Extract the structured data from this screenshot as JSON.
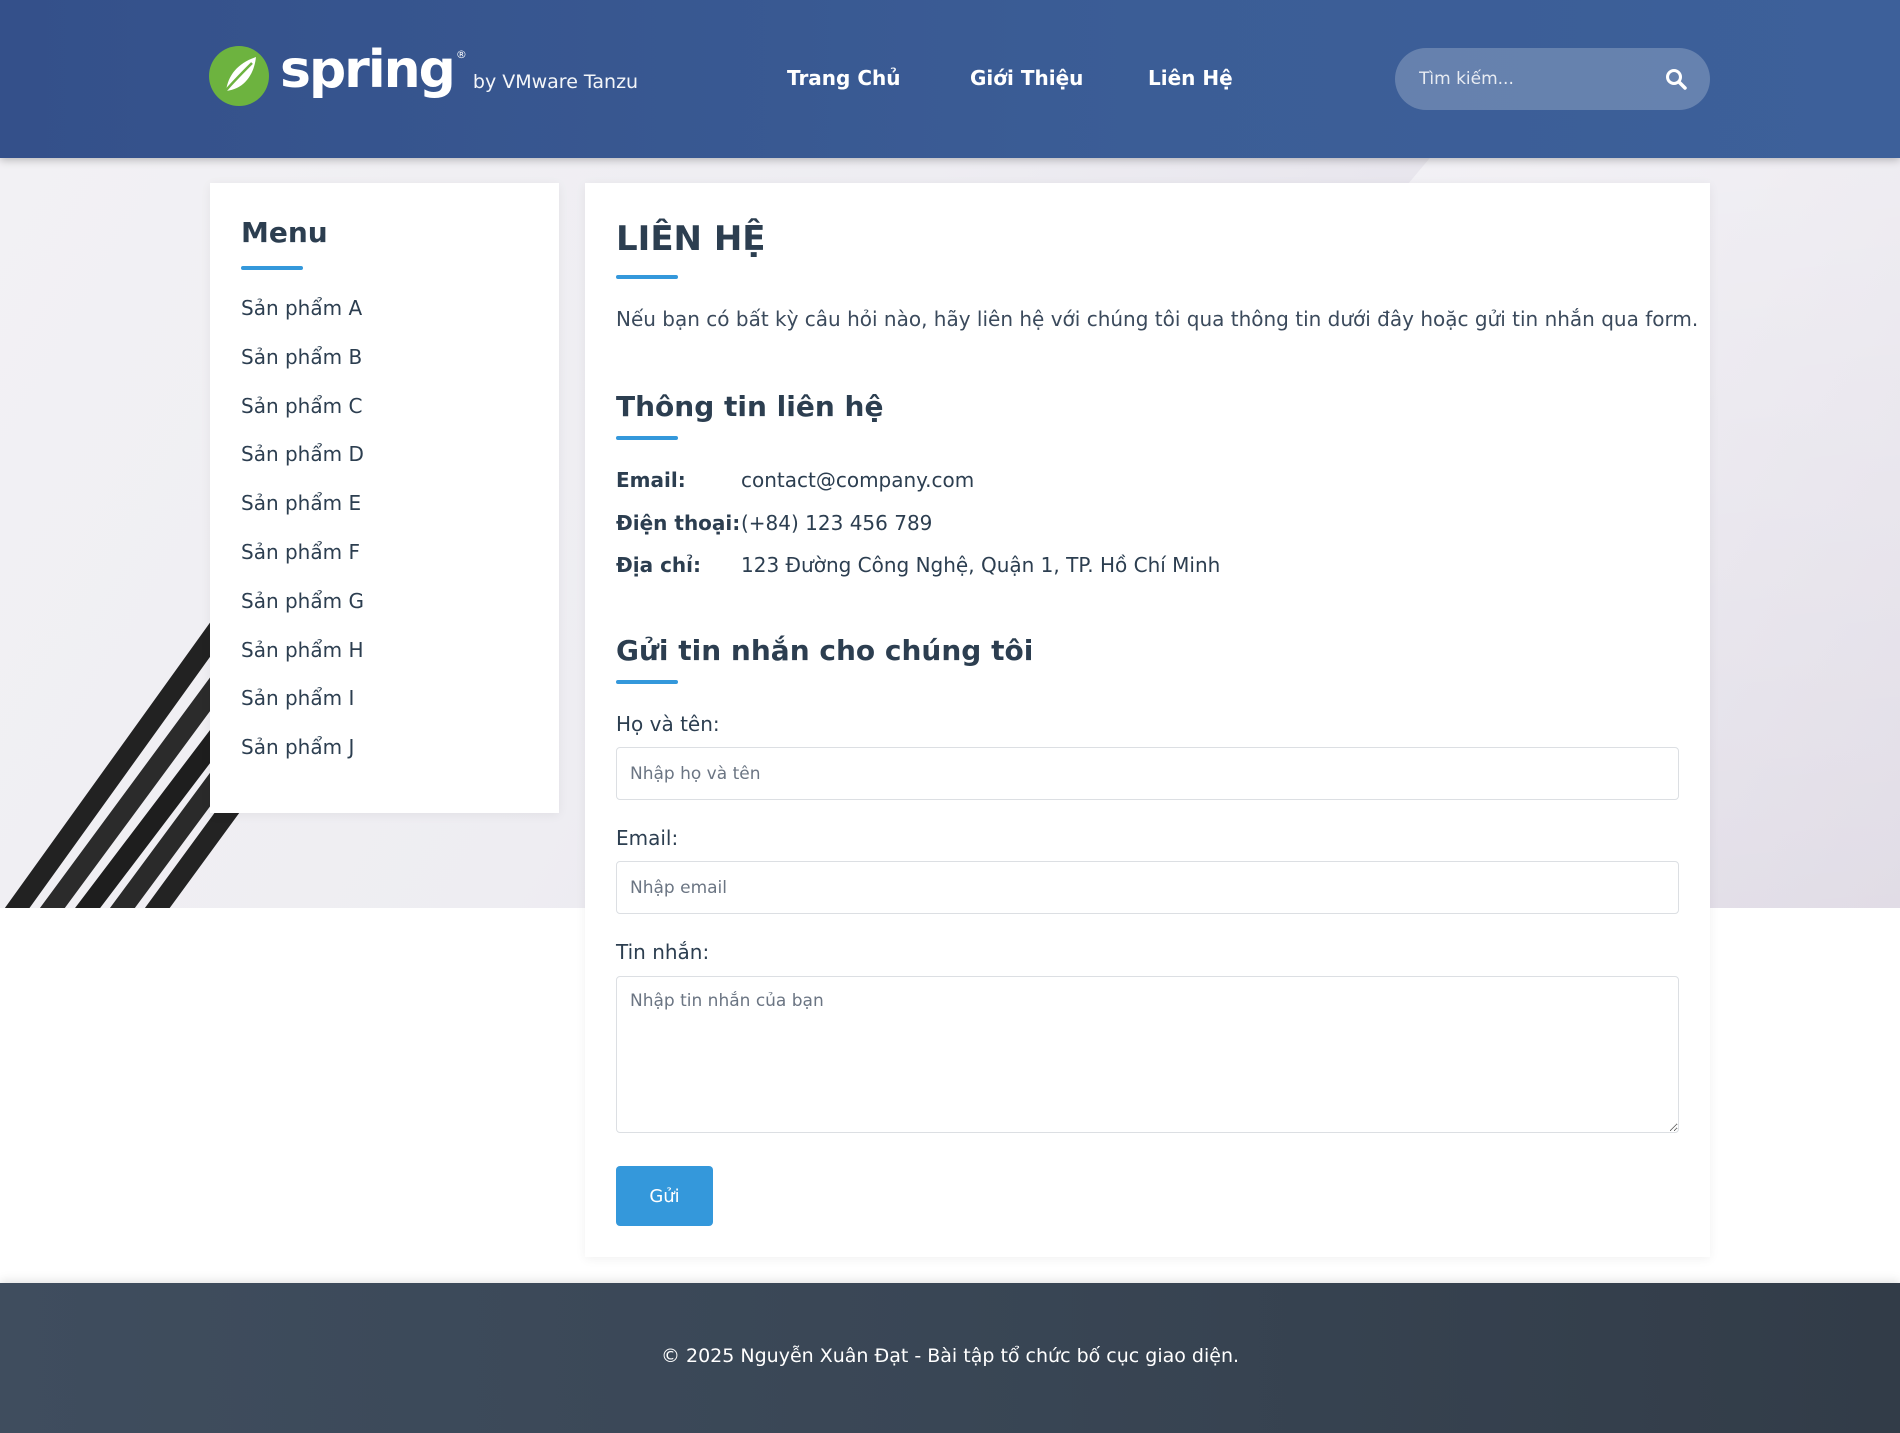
{
  "header": {
    "logo": {
      "word": "spring",
      "registered": "®",
      "byline": "by VMware Tanzu"
    },
    "nav": [
      {
        "label": "Trang Chủ"
      },
      {
        "label": "Giới Thiệu"
      },
      {
        "label": "Liên Hệ"
      }
    ],
    "search": {
      "placeholder": "Tìm kiếm...",
      "icon": "search-icon"
    }
  },
  "sidebar": {
    "title": "Menu",
    "items": [
      {
        "label": "Sản phẩm A"
      },
      {
        "label": "Sản phẩm B"
      },
      {
        "label": "Sản phẩm C"
      },
      {
        "label": "Sản phẩm D"
      },
      {
        "label": "Sản phẩm E"
      },
      {
        "label": "Sản phẩm F"
      },
      {
        "label": "Sản phẩm G"
      },
      {
        "label": "Sản phẩm H"
      },
      {
        "label": "Sản phẩm I"
      },
      {
        "label": "Sản phẩm J"
      }
    ]
  },
  "main": {
    "title": "LIÊN HỆ",
    "intro": "Nếu bạn có bất kỳ câu hỏi nào, hãy liên hệ với chúng tôi qua thông tin dưới đây hoặc gửi tin nhắn qua form.",
    "info_heading": "Thông tin liên hệ",
    "info": {
      "email_label": "Email:",
      "email_value": "contact@company.com",
      "phone_label": "Điện thoại:",
      "phone_value": "(+84) 123 456 789",
      "address_label": "Địa chỉ:",
      "address_value": "123 Đường Công Nghệ, Quận 1, TP. Hồ Chí Minh"
    },
    "form_heading": "Gửi tin nhắn cho chúng tôi",
    "form": {
      "name_label": "Họ và tên:",
      "name_placeholder": "Nhập họ và tên",
      "email_label": "Email:",
      "email_placeholder": "Nhập email",
      "message_label": "Tin nhắn:",
      "message_placeholder": "Nhập tin nhắn của bạn",
      "submit_label": "Gửi"
    }
  },
  "footer": {
    "text": "© 2025 Nguyễn Xuân Đạt - Bài tập tổ chức bố cục giao diện."
  },
  "colors": {
    "header": "#3b5d96",
    "accent": "#3498db",
    "footer": "#394655",
    "text": "#2c3e50",
    "logo_green": "#6db33f"
  }
}
